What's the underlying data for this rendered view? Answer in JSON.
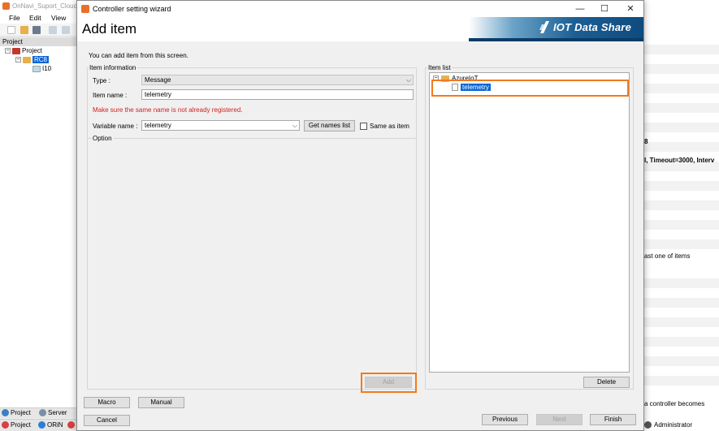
{
  "background_app": {
    "title": "OnNavi_Suport_Cloud",
    "menu": [
      "File",
      "Edit",
      "View"
    ],
    "project_panel_title": "Project",
    "tree": {
      "root": "Project",
      "controller": "RC8",
      "child": "I10"
    },
    "bottom_tabs_row1": [
      "Project",
      "Server"
    ],
    "bottom_tabs_row2": [
      "Project",
      "ORiN"
    ],
    "right_panel": {
      "text_1": "8",
      "text_2": "I, Timeout=3000, Interv",
      "text_3": "ast one of items",
      "text_4": "a controller becomes",
      "status_user": "Administrator"
    }
  },
  "dialog": {
    "window_title": "Controller setting wizard",
    "heading": "Add item",
    "brand": "IOT Data Share",
    "subtitle": "You can add item from this screen.",
    "item_information": {
      "group_label": "Item information",
      "type_label": "Type :",
      "type_value": "Message",
      "item_name_label": "Item name :",
      "item_name_value": "telemetry",
      "warning": "Make sure the same name is not already registered.",
      "variable_name_label": "Variable name :",
      "variable_name_value": "telemetry",
      "get_names_button": "Get names list",
      "same_as_item_label": "Same as item"
    },
    "option": {
      "group_label": "Option"
    },
    "add_button": "Add",
    "item_list": {
      "group_label": "Item list",
      "root": "AzureIoT",
      "items": [
        "telemetry"
      ]
    },
    "delete_button": "Delete",
    "macro_button": "Macro",
    "manual_button": "Manual",
    "cancel_button": "Cancel",
    "previous_button": "Previous",
    "next_button": "Next",
    "finish_button": "Finish"
  },
  "colors": {
    "highlight": "#f07a1e",
    "warning": "#d42020",
    "selection": "#0a64d6"
  }
}
